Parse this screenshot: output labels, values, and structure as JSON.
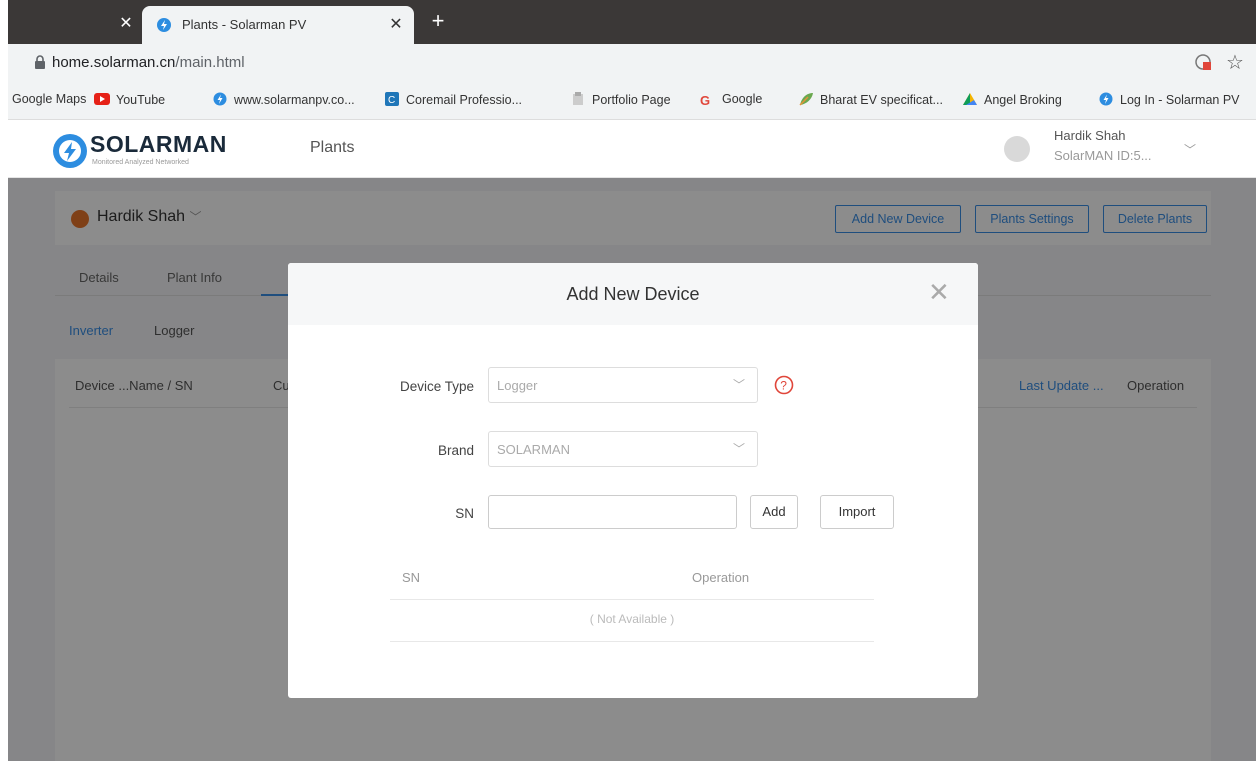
{
  "browser": {
    "active_tab_title": "Plants - Solarman PV",
    "url_host": "home.solarman.cn",
    "url_path": "/main.html",
    "bookmarks": [
      {
        "label": "Google Maps",
        "icon": "none"
      },
      {
        "label": "YouTube",
        "icon": "youtube-icon"
      },
      {
        "label": "www.solarmanpv.co...",
        "icon": "solarman-icon"
      },
      {
        "label": "Coremail Professio...",
        "icon": "coremail-icon"
      },
      {
        "label": "Portfolio Page",
        "icon": "portfolio-icon"
      },
      {
        "label": "Google",
        "icon": "google-icon"
      },
      {
        "label": "Bharat EV specificat...",
        "icon": "leaf-icon"
      },
      {
        "label": "Angel Broking",
        "icon": "drive-icon"
      },
      {
        "label": "Log In - Solarman PV",
        "icon": "solarman-icon"
      }
    ]
  },
  "header": {
    "logo_text": "SOLARMAN",
    "logo_subtitle": "Monitored  Analyzed  Networked",
    "nav_plants": "Plants",
    "user_name": "Hardik Shah",
    "user_id": "SolarMAN ID:5..."
  },
  "plant_bar": {
    "plant_name": "Hardik Shah",
    "add_device_label": "Add New Device",
    "plants_settings_label": "Plants Settings",
    "delete_plants_label": "Delete Plants"
  },
  "tabs": {
    "details": "Details",
    "plant_info": "Plant Info"
  },
  "subtabs": {
    "inverter": "Inverter",
    "logger": "Logger"
  },
  "table": {
    "col_device": "Device ...Name / SN",
    "col_cu": "Cu",
    "col_last_update": "Last Update ...",
    "col_operation": "Operation"
  },
  "modal": {
    "title": "Add New Device",
    "device_type_label": "Device Type",
    "device_type_value": "Logger",
    "brand_label": "Brand",
    "brand_value": "SOLARMAN",
    "sn_label": "SN",
    "sn_value": "",
    "add_label": "Add",
    "import_label": "Import",
    "list_col_sn": "SN",
    "list_col_operation": "Operation",
    "list_empty": "( Not Available )"
  },
  "colors": {
    "accent": "#3a8ee6",
    "help": "#e0463a",
    "plant_icon": "#e8752a"
  }
}
